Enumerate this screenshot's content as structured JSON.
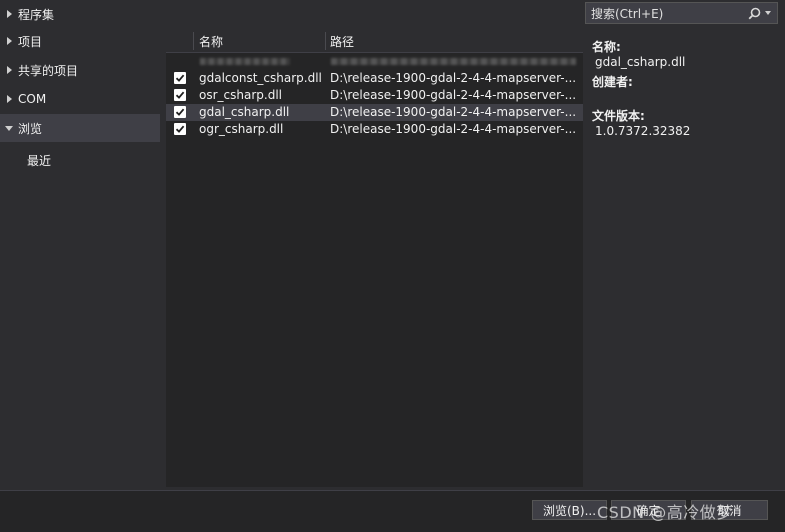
{
  "nav": {
    "items": [
      {
        "label": "程序集",
        "expanded": false
      },
      {
        "label": "项目",
        "expanded": false
      },
      {
        "label": "共享的项目",
        "expanded": false
      },
      {
        "label": "COM",
        "expanded": false
      },
      {
        "label": "浏览",
        "expanded": true
      }
    ],
    "sub_items": [
      {
        "label": "最近"
      }
    ]
  },
  "table": {
    "columns": [
      "名称",
      "路径"
    ],
    "rows": [
      {
        "checked": true,
        "name": "gdalconst_csharp.dll",
        "path": "D:\\release-1900-gdal-2-4-4-mapserver-..."
      },
      {
        "checked": true,
        "name": "osr_csharp.dll",
        "path": "D:\\release-1900-gdal-2-4-4-mapserver-..."
      },
      {
        "checked": true,
        "name": "gdal_csharp.dll",
        "path": "D:\\release-1900-gdal-2-4-4-mapserver-...",
        "selected": true
      },
      {
        "checked": true,
        "name": "ogr_csharp.dll",
        "path": "D:\\release-1900-gdal-2-4-4-mapserver-..."
      }
    ]
  },
  "search": {
    "placeholder": "搜索(Ctrl+E)",
    "icon": "search-icon"
  },
  "details": {
    "name_label": "名称:",
    "name_value": "gdal_csharp.dll",
    "creator_label": "创建者:",
    "creator_value": "",
    "version_label": "文件版本:",
    "version_value": "1.0.7372.32382"
  },
  "footer": {
    "browse_label": "浏览(B)...",
    "ok_label": "确定",
    "cancel_label": "取消",
    "watermark": "CSDN @高冷做梦"
  },
  "colors": {
    "background": "#2d2d30",
    "panel": "#252526",
    "selection": "#3f3f46",
    "text": "#f1f1f1"
  }
}
